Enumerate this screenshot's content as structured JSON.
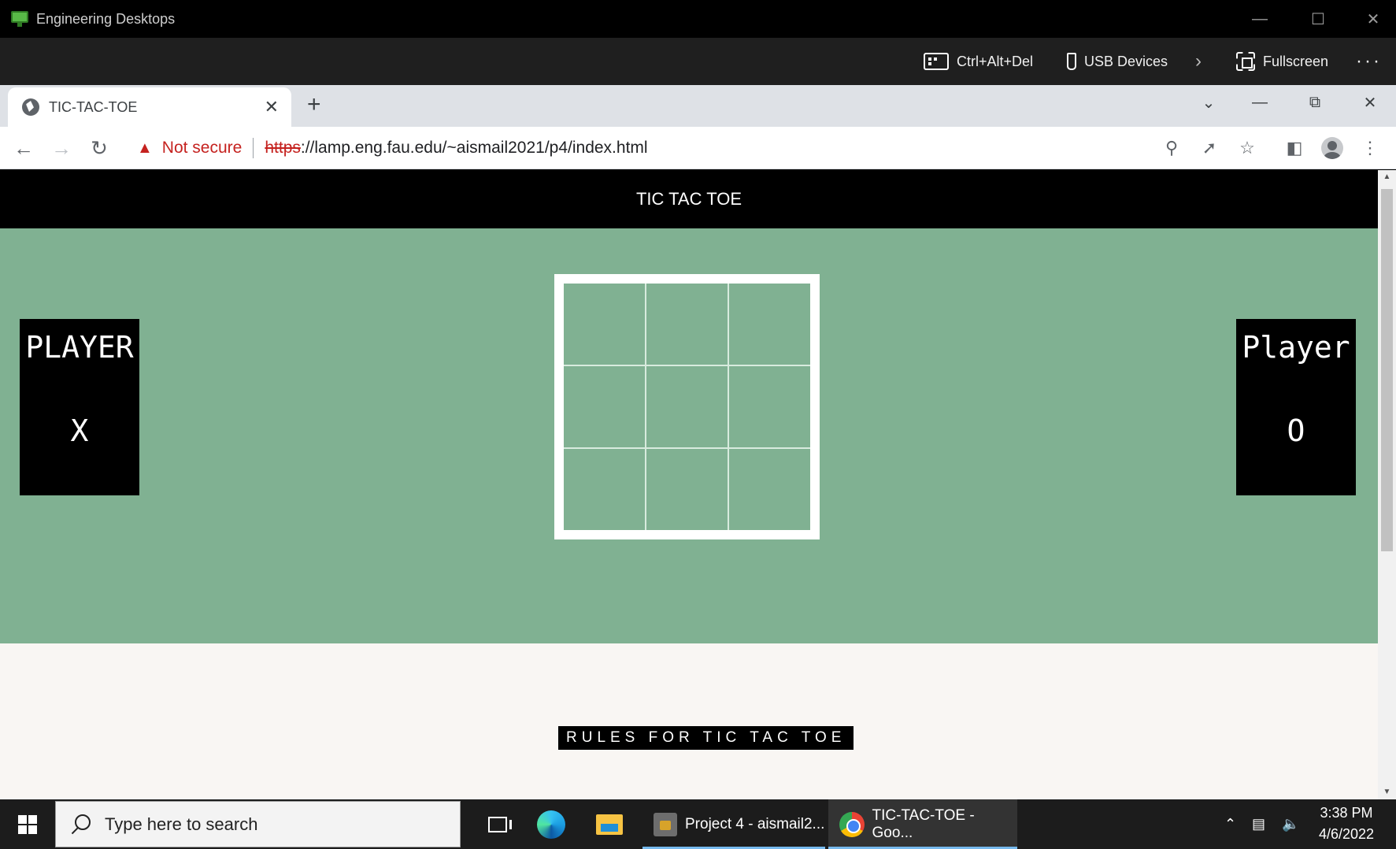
{
  "remote_desktop": {
    "title": "Engineering Desktops",
    "toolbar": {
      "ctrl_alt_del": "Ctrl+Alt+Del",
      "usb_devices": "USB Devices",
      "fullscreen": "Fullscreen"
    }
  },
  "browser": {
    "tab_title": "TIC-TAC-TOE",
    "security_label": "Not secure",
    "url_scheme": "https",
    "url_rest": "://lamp.eng.fau.edu/~aismail2021/p4/index.html"
  },
  "page": {
    "header_title": "TIC TAC TOE",
    "player_left": {
      "label": "PLAYER",
      "symbol": "X"
    },
    "player_right": {
      "label": "Player",
      "symbol": "O"
    },
    "board_cells": [
      "",
      "",
      "",
      "",
      "",
      "",
      "",
      "",
      ""
    ],
    "rules_button": "RULES FOR TIC TAC TOE",
    "colors": {
      "game_bg": "#80b192",
      "header_bg": "#000000",
      "page_bg": "#f9f6f3"
    }
  },
  "taskbar": {
    "search_placeholder": "Type here to search",
    "apps": [
      {
        "label": "Project 4 - aismail2..."
      },
      {
        "label": "TIC-TAC-TOE - Goo..."
      }
    ],
    "clock_time": "3:38 PM",
    "clock_date": "4/6/2022"
  }
}
